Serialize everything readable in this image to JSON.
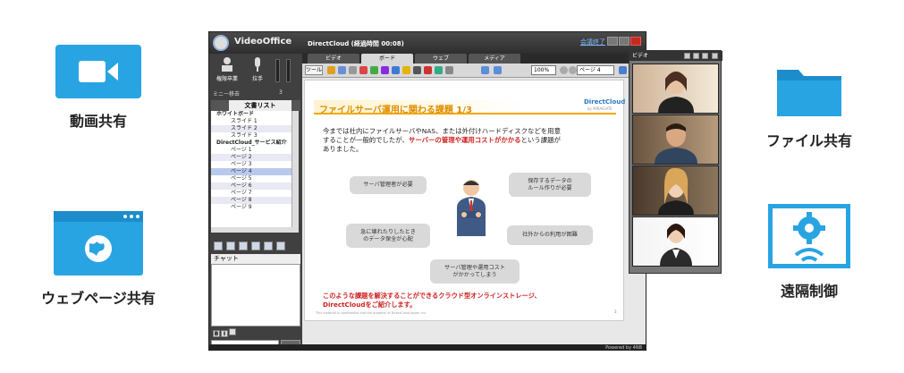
{
  "features": {
    "video": "動画共有",
    "web": "ウェブページ共有",
    "file": "ファイル共有",
    "remote": "遠隔制御"
  },
  "app": {
    "name": "VideoOffice",
    "window_title": "DirectCloud (経過時間 00:08)",
    "end_link": "会議終了",
    "tools": {
      "share": "権限卒業",
      "mic": "拉手"
    },
    "mini_label": "ミニー移去",
    "mini_count": "3",
    "doc_tab": "文書リスト",
    "tree": [
      {
        "label": "ホワイトボード",
        "cls": ""
      },
      {
        "label": "スライド 1",
        "cls": ""
      },
      {
        "label": "スライド 2",
        "cls": "g"
      },
      {
        "label": "スライド 3",
        "cls": ""
      },
      {
        "label": "DirectCloud_サービス紹介",
        "cls": ""
      },
      {
        "label": "ページ 1",
        "cls": ""
      },
      {
        "label": "ページ 2",
        "cls": "g"
      },
      {
        "label": "ページ 3",
        "cls": ""
      },
      {
        "label": "ページ 4",
        "cls": "sel"
      },
      {
        "label": "ページ 5",
        "cls": ""
      },
      {
        "label": "ページ 6",
        "cls": "g"
      },
      {
        "label": "ページ 7",
        "cls": ""
      },
      {
        "label": "ページ 8",
        "cls": "g"
      },
      {
        "label": "ページ 9",
        "cls": ""
      }
    ],
    "chat_label": "チャット",
    "tabs": [
      "ビデオ",
      "ボード",
      "ウェブ",
      "メディア"
    ],
    "tool_label": "ツール",
    "zoom": "100%",
    "page_select": "ページ 4",
    "powered": "Powered by 4NB"
  },
  "slide": {
    "title": "ファイルサーバ運用に関わる課題 1/3",
    "logo": "DirectCloud",
    "logo_sub": "by MIRAIGATE",
    "body_1": "今までは社内にファイルサーバやNAS、または外付けハードディスクなどを用意",
    "body_2a": "することが一般的でしたが、",
    "body_2b": "サーバーの管理や運用コストがかかる",
    "body_2c": "という課題が",
    "body_3": "ありました。",
    "bubbles": [
      "サーバ管理者が必要",
      "保存するデータの\nルール作りが必要",
      "急に壊れたりしたとき\nのデータ保全が心配",
      "社外からの利用が困難",
      "サーバ管理や運用コスト\nがかかってしまう"
    ],
    "footer_1": "このような課題を解決することができるクラウド型オンラインストレージ、",
    "footer_2": "DirectCloudをご紹介します。",
    "confidential": "This material is confidential and the property of DirectCloud Japan, Inc.",
    "page_num": "3"
  },
  "video_panel": {
    "label": "ビデオ"
  }
}
